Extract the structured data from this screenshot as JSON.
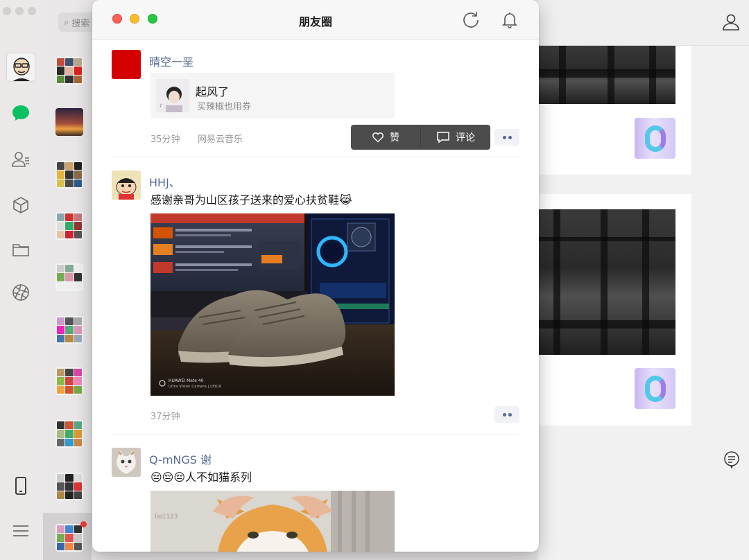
{
  "background_app": {
    "search_placeholder": "搜索",
    "sidebar_icons": [
      "chat-icon",
      "contacts-icon",
      "box-icon",
      "folder-icon",
      "aperture-icon",
      "phone-icon",
      "menu-icon"
    ],
    "accent_color": "#07c160"
  },
  "window": {
    "title": "朋友圈",
    "refresh_icon": "refresh-icon",
    "bell_icon": "bell-icon"
  },
  "posts": [
    {
      "author": "晴空一垩",
      "avatar_color": "#d40000",
      "music": {
        "title": "起风了",
        "subtitle": "买辣椒也用券"
      },
      "time": "35分钟",
      "source": "网易云音乐"
    },
    {
      "author": "HHJ、",
      "text": "感谢亲哥为山区孩子送来的爱心扶贫鞋😹",
      "time": "37分钟",
      "photo_caption_line1": "HUAWEI Mate 40",
      "photo_caption_line2": "Ultra Vision Camera | LEICA"
    },
    {
      "author": "Q-mNGS 谢",
      "text": "😔😔😔人不如猫系列",
      "photo_watermark": "lio1123"
    }
  ],
  "action_popup": {
    "like_label": "赞",
    "comment_label": "评论"
  },
  "colors": {
    "name_link": "#576b95",
    "popup_bg": "#4c4c4c"
  }
}
